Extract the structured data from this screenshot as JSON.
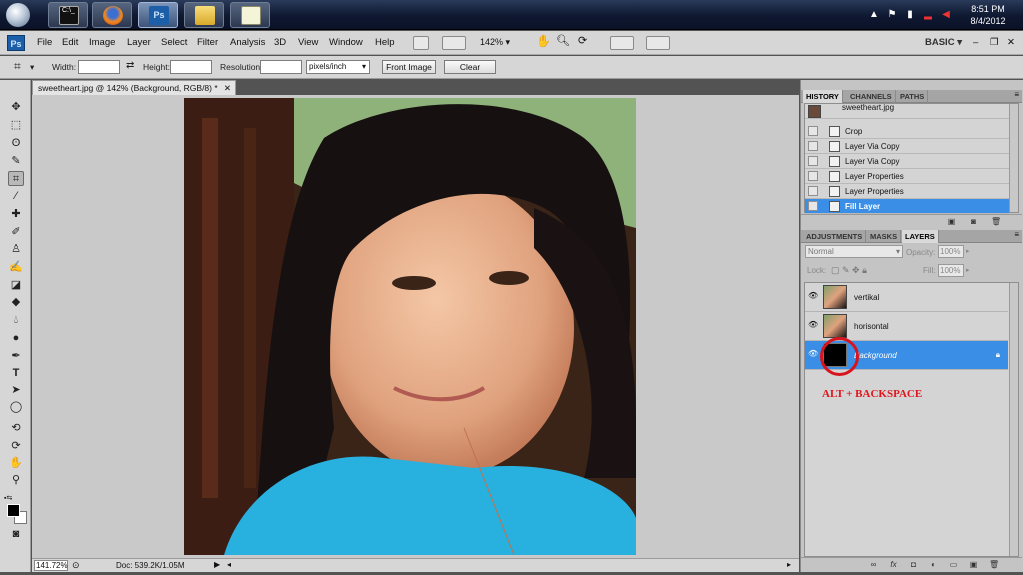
{
  "taskbar": {
    "time": "8:51 PM",
    "date": "8/4/2012",
    "buttons": [
      "cmd",
      "firefox",
      "photoshop",
      "explorer",
      "notepad"
    ]
  },
  "menubar": {
    "items": [
      "File",
      "Edit",
      "Image",
      "Layer",
      "Select",
      "Filter",
      "Analysis",
      "3D",
      "View",
      "Window",
      "Help"
    ],
    "zoom": "142%",
    "workspace": "BASIC"
  },
  "options": {
    "width_label": "Width:",
    "height_label": "Height:",
    "resolution_label": "Resolution:",
    "units": "pixels/inch",
    "front_image": "Front Image",
    "clear": "Clear"
  },
  "document": {
    "tab_title": "sweetheart.jpg @ 142% (Background, RGB/8) *",
    "zoom_status": "141.72%",
    "doc_status": "Doc: 539.2K/1.05M"
  },
  "history": {
    "tabs": [
      "HISTORY",
      "CHANNELS",
      "PATHS"
    ],
    "snapshot": "sweetheart.jpg",
    "items": [
      "Crop",
      "Layer Via Copy",
      "Layer Via Copy",
      "Layer Properties",
      "Layer Properties",
      "Fill Layer"
    ],
    "selected_index": 5
  },
  "layers_panel": {
    "tabs": [
      "ADJUSTMENTS",
      "MASKS",
      "LAYERS"
    ],
    "blend_mode": "Normal",
    "opacity_label": "Opacity:",
    "opacity": "100%",
    "lock_label": "Lock:",
    "fill_label": "Fill:",
    "fill": "100%",
    "layers": [
      "vertikal",
      "horisontal",
      "Background"
    ],
    "selected": "Background"
  },
  "annotation": "ALT + BACKSPACE",
  "colors": {
    "selection": "#3a8ee6",
    "annotation": "#e0141c",
    "ps_blue": "#1c5ea7"
  }
}
